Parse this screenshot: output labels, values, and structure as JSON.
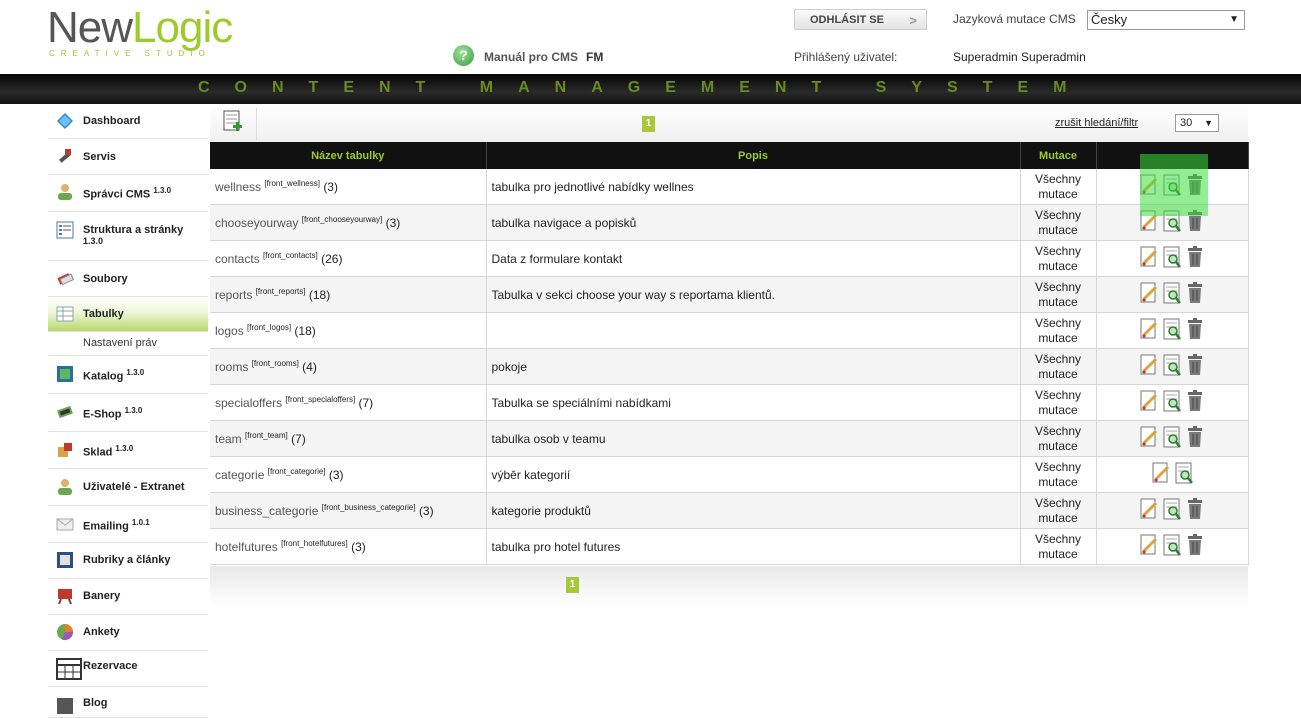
{
  "header": {
    "logo_new": "New",
    "logo_logic": "Logic",
    "logo_sub": "CREATIVE STUDIO",
    "logout_label": "ODHLÁSIT SE",
    "lang_label": "Jazyková mutace CMS",
    "lang_value": "Česky",
    "manual_label": "Manuál pro CMS",
    "fm_label": "FM",
    "user_label": "Přihlášený uživatel:",
    "user_name": "Superadmin Superadmin",
    "banner": "CONTENT MANAGEMENT SYSTEM"
  },
  "sidebar": {
    "items": [
      {
        "label": "Dashboard",
        "icon": "dashboard-icon"
      },
      {
        "label": "Servis",
        "icon": "servis-icon"
      },
      {
        "label": "Správci CMS",
        "ver": "1.3.0",
        "icon": "admins-icon"
      },
      {
        "label": "Struktura a stránky",
        "ver": "1.3.0",
        "icon": "structure-icon"
      },
      {
        "label": "Soubory",
        "icon": "files-icon"
      },
      {
        "label": "Tabulky",
        "icon": "tables-icon"
      },
      {
        "label": "Nastavení práv"
      },
      {
        "label": "Katalog",
        "ver": "1.3.0",
        "icon": "catalog-icon"
      },
      {
        "label": "E-Shop",
        "ver": "1.3.0",
        "icon": "eshop-icon"
      },
      {
        "label": "Sklad",
        "ver": "1.3.0",
        "icon": "warehouse-icon"
      },
      {
        "label": "Uživatelé - Extranet",
        "icon": "users-icon"
      },
      {
        "label": "Emailing",
        "ver": "1.0.1",
        "icon": "email-icon"
      },
      {
        "label": "Rubriky a články",
        "icon": "articles-icon"
      },
      {
        "label": "Banery",
        "icon": "banners-icon"
      },
      {
        "label": "Ankety",
        "icon": "polls-icon"
      },
      {
        "label": "Rezervace",
        "icon": "reservation-icon"
      },
      {
        "label": "Blog",
        "icon": "blog-icon"
      }
    ]
  },
  "toolbar": {
    "page": "1",
    "reset_label": "zrušit hledání/filtr",
    "per_page": "30"
  },
  "table": {
    "headers": [
      "Název tabulky",
      "Popis",
      "Mutace",
      ""
    ],
    "rows": [
      {
        "name": "wellness",
        "key": "[front_wellness]",
        "count": "(3)",
        "desc": "tabulka pro jednotlivé nabídky wellnes",
        "mut1": "Všechny",
        "mut2": "mutace",
        "delete": true
      },
      {
        "name": "chooseyourway",
        "key": "[front_chooseyourway]",
        "count": "(3)",
        "desc": "tabulka navigace a popisků",
        "mut1": "Všechny",
        "mut2": "mutace",
        "delete": true
      },
      {
        "name": "contacts",
        "key": "[front_contacts]",
        "count": "(26)",
        "desc": "Data z formulare kontakt",
        "mut1": "Všechny",
        "mut2": "mutace",
        "delete": true
      },
      {
        "name": "reports",
        "key": "[front_reports]",
        "count": "(18)",
        "desc": "Tabulka v sekci choose your way s reportama klientů.",
        "mut1": "Všechny",
        "mut2": "mutace",
        "delete": true
      },
      {
        "name": "logos",
        "key": "[front_logos]",
        "count": "(18)",
        "desc": "",
        "mut1": "Všechny",
        "mut2": "mutace",
        "delete": true
      },
      {
        "name": "rooms",
        "key": "[front_rooms]",
        "count": "(4)",
        "desc": "pokoje",
        "mut1": "Všechny",
        "mut2": "mutace",
        "delete": true
      },
      {
        "name": "specialoffers",
        "key": "[front_specialoffers]",
        "count": "(7)",
        "desc": "Tabulka se speciálními nabídkami",
        "mut1": "Všechny",
        "mut2": "mutace",
        "delete": true
      },
      {
        "name": "team",
        "key": "[front_team]",
        "count": "(7)",
        "desc": "tabulka osob v teamu",
        "mut1": "Všechny",
        "mut2": "mutace",
        "delete": true
      },
      {
        "name": "categorie",
        "key": "[front_categorie]",
        "count": "(3)",
        "desc": "výběr kategorií",
        "mut1": "Všechny",
        "mut2": "mutace",
        "delete": false
      },
      {
        "name": "business_categorie",
        "key": "[front_business_categorie]",
        "count": "(3)",
        "desc": "kategorie produktů",
        "mut1": "Všechny",
        "mut2": "mutace",
        "delete": true
      },
      {
        "name": "hotelfutures",
        "key": "[front_hotelfutures]",
        "count": "(3)",
        "desc": "tabulka pro hotel futures",
        "mut1": "Všechny",
        "mut2": "mutace",
        "delete": true
      }
    ]
  },
  "colors": {
    "accent": "#9ccb2b",
    "header_bg": "#111111",
    "pager": "#a8c73a"
  }
}
